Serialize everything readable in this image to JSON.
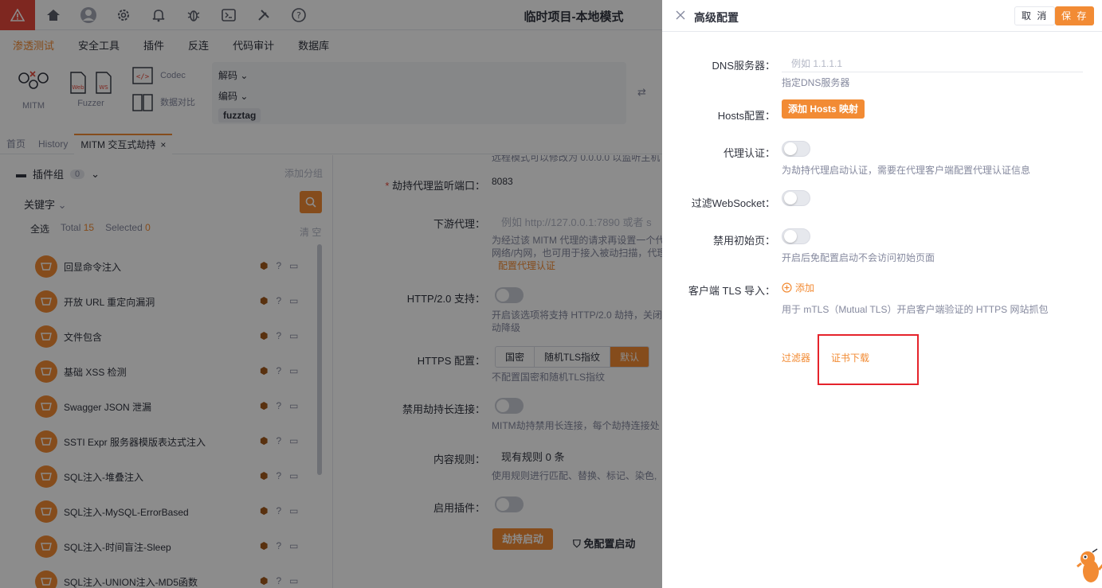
{
  "app": {
    "title": "临时项目-本地模式",
    "menu": [
      "渗透测试",
      "安全工具",
      "插件",
      "反连",
      "代码审计",
      "数据库"
    ],
    "active_menu": "渗透测试"
  },
  "toolbar": {
    "mitm": "MITM",
    "fuzzer": "Fuzzer",
    "codec": "Codec",
    "data_compare": "数据对比",
    "decode": "解码",
    "encode": "编码",
    "fuzztag": "fuzztag"
  },
  "tabs": [
    "首页",
    "History",
    "MITM 交互式劫持"
  ],
  "plugins": {
    "group_label": "插件组",
    "group_count": "0",
    "add_group": "添加分组",
    "keyword": "关键字",
    "select_all": "全选",
    "total_label": "Total",
    "total": "15",
    "selected_label": "Selected",
    "selected": "0",
    "clear": "清 空",
    "items": [
      "回显命令注入",
      "开放 URL 重定向漏洞",
      "文件包含",
      "基础 XSS 检测",
      "Swagger JSON 泄漏",
      "SSTI Expr 服务器模版表达式注入",
      "SQL注入-堆叠注入",
      "SQL注入-MySQL-ErrorBased",
      "SQL注入-时间盲注-Sleep",
      "SQL注入-UNION注入-MD5函数"
    ]
  },
  "mitm_form": {
    "top_hint": "远程模式可以修改为 0.0.0.0 以监听主机",
    "port_label": "劫持代理监听端口：",
    "port_value": "8083",
    "downstream_label": "下游代理：",
    "downstream_placeholder": "例如 http://127.0.0.1:7890 或者 s",
    "downstream_hint1": "为经过该 MITM 代理的请求再设置一个代",
    "downstream_hint2": "网络/内网，也可用于接入被动扫描，代理",
    "downstream_link": "配置代理认证",
    "http2_label": "HTTP/2.0 支持：",
    "http2_hint1": "开启该选项将支持 HTTP/2.0 劫持，关闭",
    "http2_hint2": "动降级",
    "https_label": "HTTPS 配置：",
    "https_options": [
      "国密",
      "随机TLS指纹",
      "默认"
    ],
    "https_hint": "不配置国密和随机TLS指纹",
    "keepalive_label": "禁用劫持长连接：",
    "keepalive_hint": "MITM劫持禁用长连接，每个劫持连接处",
    "rules_label": "内容规则：",
    "rules_value": "现有规则 0 条",
    "rules_hint": "使用规则进行匹配、替换、标记、染色,",
    "plugin_label": "启用插件：",
    "start_button": "劫持启动",
    "noconf_button": "免配置启动"
  },
  "drawer": {
    "title": "高级配置",
    "cancel": "取 消",
    "save": "保 存",
    "dns_label": "DNS服务器：",
    "dns_placeholder": "例如 1.1.1.1",
    "dns_hint": "指定DNS服务器",
    "hosts_label": "Hosts配置：",
    "hosts_button": "添加 Hosts 映射",
    "auth_label": "代理认证：",
    "auth_hint": "为劫持代理启动认证，需要在代理客户端配置代理认证信息",
    "ws_label": "过滤WebSocket：",
    "init_label": "禁用初始页：",
    "init_hint": "开启后免配置启动不会访问初始页面",
    "tls_label": "客户端 TLS 导入：",
    "tls_add": "添加",
    "tls_hint": "用于 mTLS（Mutual TLS）开启客户端验证的 HTTPS 网站抓包",
    "filter_link": "过滤器",
    "cert_link": "证书下载"
  },
  "colors": {
    "accent": "#f28b34",
    "warn": "#e5483b",
    "highlight_box": "#e5232b"
  }
}
